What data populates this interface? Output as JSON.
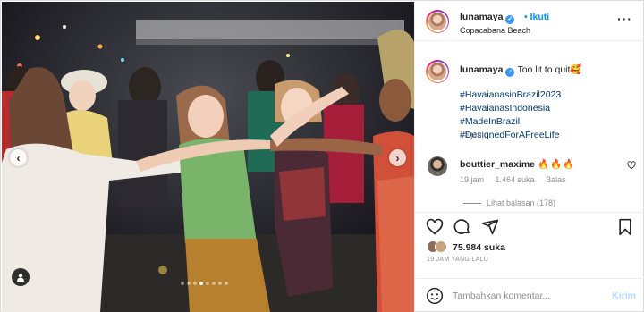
{
  "post": {
    "username": "lunamaya",
    "follow_label": "Ikuti",
    "location": "Copacabana Beach",
    "more_glyph": "···"
  },
  "caption": {
    "username": "lunamaya",
    "text": "Too lit to quit🥰",
    "hashtags": [
      "#HavaianasinBrazil2023",
      "#HavaianasIndonesia",
      "#MadeInBrazil",
      "#DesignedForAFreeLife"
    ],
    "time": "19 jam"
  },
  "comment": {
    "username": "bouttier_maxime",
    "text": "🔥🔥🔥",
    "time": "19 jam",
    "likes": "1.464 suka",
    "reply_label": "Balas",
    "view_replies": "Lihat balasan (178)"
  },
  "engagement": {
    "likes": "75.984 suka",
    "posted_ago": "19 JAM YANG LALU"
  },
  "add_comment": {
    "placeholder": "Tambahkan komentar...",
    "post_label": "Kirim"
  },
  "carousel": {
    "slide_count": 8,
    "active_index": 3
  },
  "colors": {
    "link": "#0095f6",
    "hashtag": "#00376b",
    "muted": "#8e8e8e",
    "verified": "#3897f0"
  },
  "icons": [
    "chevron-left-icon",
    "chevron-right-icon",
    "user-tag-icon",
    "verified-icon",
    "more-icon",
    "heart-icon",
    "comment-icon",
    "share-icon",
    "bookmark-icon",
    "emoji-icon"
  ]
}
